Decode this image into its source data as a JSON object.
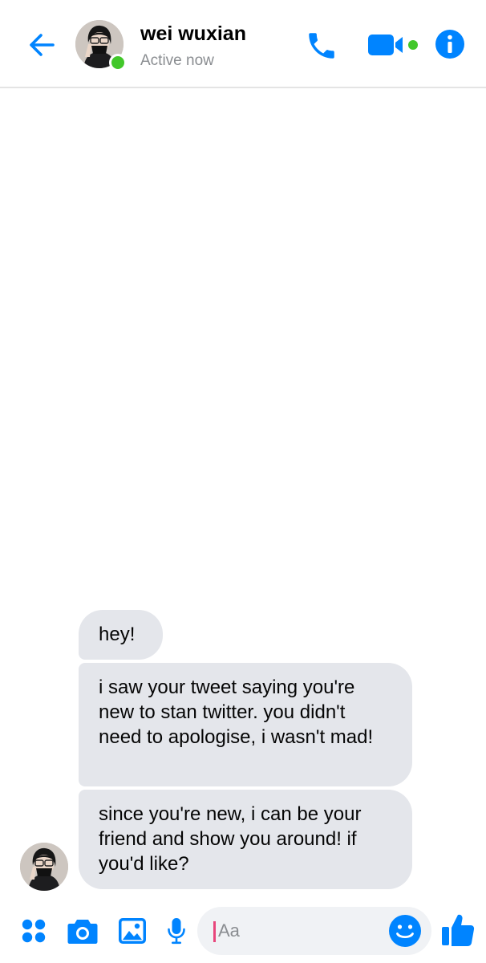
{
  "colors": {
    "accent": "#0084ff",
    "online": "#42c72a",
    "bubble_bg": "#e4e6eb",
    "input_bg": "#f0f2f5",
    "caret": "#e8467c"
  },
  "header": {
    "back_icon": "arrow-left-icon",
    "contact_name": "wei wuxian",
    "status": "Active now",
    "actions": [
      "phone-icon",
      "video-camera-icon",
      "info-icon"
    ]
  },
  "messages": [
    {
      "sender": "wei wuxian",
      "text": "hey!"
    },
    {
      "sender": "wei wuxian",
      "text": "i saw your tweet saying you're new to stan twitter. you didn't need to apologise, i wasn't mad!"
    },
    {
      "sender": "wei wuxian",
      "text": "since you're new, i can be your friend and show you around! if you'd like?"
    }
  ],
  "composer": {
    "placeholder": "Aa",
    "icons": [
      "apps-icon",
      "camera-icon",
      "image-icon",
      "microphone-icon",
      "emoji-icon",
      "thumbs-up-icon"
    ]
  }
}
